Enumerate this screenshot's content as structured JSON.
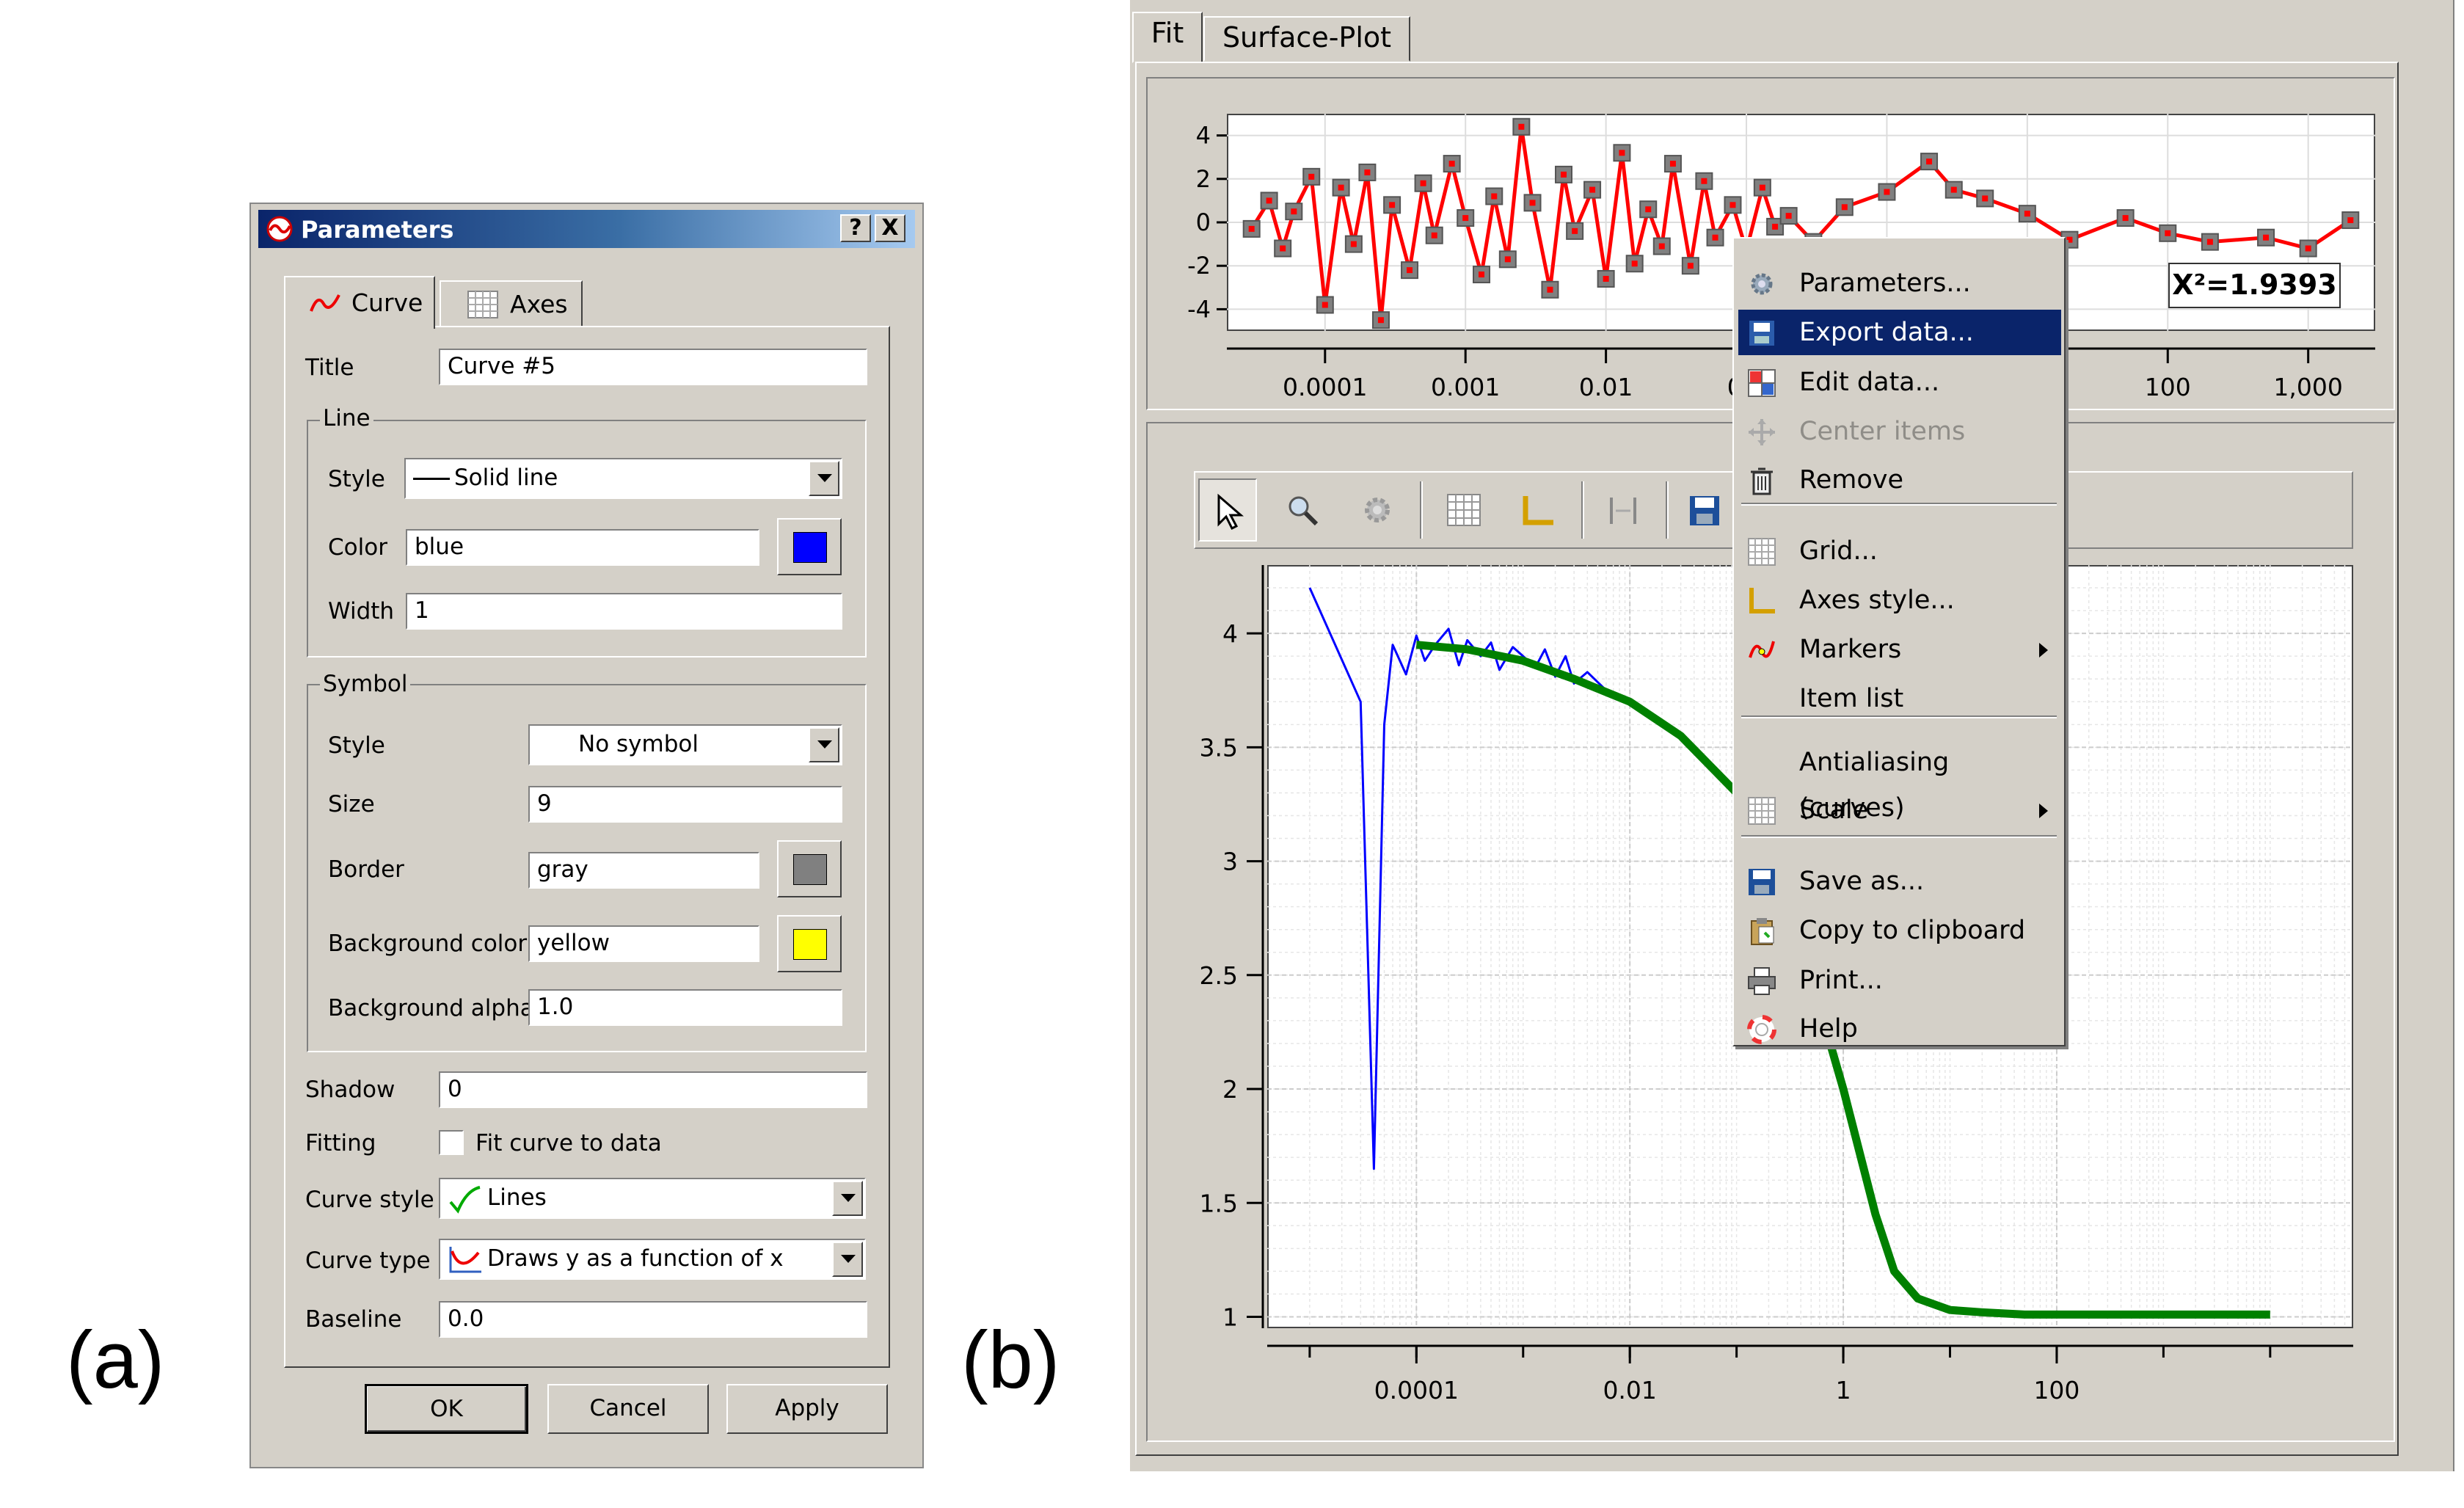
{
  "panels": {
    "a": "(a)",
    "b": "(b)"
  },
  "dialog": {
    "title": "Parameters",
    "help_btn": "?",
    "close_btn": "X",
    "tabs": [
      {
        "label": "Curve"
      },
      {
        "label": "Axes"
      }
    ],
    "title_label": "Title",
    "title_value": "Curve #5",
    "line": {
      "group": "Line",
      "style_label": "Style",
      "style_value": "Solid line",
      "color_label": "Color",
      "color_value": "blue",
      "color_swatch": "#0000ff",
      "width_label": "Width",
      "width_value": "1"
    },
    "symbol": {
      "group": "Symbol",
      "style_label": "Style",
      "style_value": "No symbol",
      "size_label": "Size",
      "size_value": "9",
      "border_label": "Border",
      "border_value": "gray",
      "border_swatch": "#808080",
      "bg_label": "Background color",
      "bg_value": "yellow",
      "bg_swatch": "#ffff00",
      "alpha_label": "Background alpha",
      "alpha_value": "1.0"
    },
    "shadow_label": "Shadow",
    "shadow_value": "0",
    "fitting_label": "Fitting",
    "fitting_check_label": "Fit curve to data",
    "fitting_checked": false,
    "curve_style_label": "Curve style",
    "curve_style_value": "Lines",
    "curve_type_label": "Curve type",
    "curve_type_value": "Draws y as a function of x",
    "baseline_label": "Baseline",
    "baseline_value": "0.0",
    "buttons": {
      "ok": "OK",
      "cancel": "Cancel",
      "apply": "Apply"
    }
  },
  "plot_window": {
    "tabs": [
      {
        "label": "Fit"
      },
      {
        "label": "Surface-Plot"
      }
    ],
    "chi2_label": "X²=1.9393",
    "toolbar_icons": [
      "pointer-icon",
      "zoom-icon",
      "gear-icon",
      "grid-icon",
      "axes-icon",
      "markers-icon",
      "save-icon"
    ]
  },
  "context_menu": {
    "items": [
      {
        "label": "Parameters...",
        "icon": "gear-icon",
        "state": "normal"
      },
      {
        "label": "Export data...",
        "icon": "export-icon",
        "state": "selected"
      },
      {
        "label": "Edit data...",
        "icon": "table-icon",
        "state": "normal"
      },
      {
        "label": "Center items",
        "icon": "move-icon",
        "state": "disabled"
      },
      {
        "label": "Remove",
        "icon": "trash-icon",
        "state": "normal"
      },
      {
        "label": "Grid...",
        "icon": "grid-icon",
        "state": "normal"
      },
      {
        "label": "Axes style...",
        "icon": "axes-icon",
        "state": "normal"
      },
      {
        "label": "Markers",
        "icon": "markers-icon",
        "state": "submenu"
      },
      {
        "label": "Item list",
        "icon": "",
        "state": "normal"
      },
      {
        "label": "Antialiasing (curves)",
        "icon": "",
        "state": "normal"
      },
      {
        "label": "Scale",
        "icon": "grid-icon",
        "state": "submenu"
      },
      {
        "label": "Save as...",
        "icon": "save-icon",
        "state": "normal"
      },
      {
        "label": "Copy to clipboard",
        "icon": "clipboard-icon",
        "state": "normal"
      },
      {
        "label": "Print...",
        "icon": "print-icon",
        "state": "normal"
      },
      {
        "label": "Help",
        "icon": "help-icon",
        "state": "normal"
      }
    ]
  },
  "chart_data": [
    {
      "type": "scatter",
      "title": "",
      "scale": "log-x",
      "x_ticks": [
        "0.0001",
        "0.001",
        "0.01",
        "0.1",
        "100",
        "1,000"
      ],
      "y_ticks": [
        "4",
        "2",
        "0",
        "-2",
        "-4"
      ],
      "ylim": [
        -5,
        5
      ],
      "series": [
        {
          "color": "#ff0000",
          "marker_color": "#808080",
          "x": [
            3e-05,
            4e-05,
            5e-05,
            6e-05,
            8e-05,
            0.0001,
            0.00013,
            0.00016,
            0.0002,
            0.00025,
            0.0003,
            0.0004,
            0.0005,
            0.0006,
            0.0008,
            0.001,
            0.0013,
            0.0016,
            0.002,
            0.0025,
            0.003,
            0.004,
            0.005,
            0.006,
            0.008,
            0.01,
            0.013,
            0.016,
            0.02,
            0.025,
            0.03,
            0.04,
            0.05,
            0.06,
            0.08,
            0.1,
            0.13,
            0.16,
            0.2,
            0.3,
            0.5,
            1,
            2,
            3,
            5,
            10,
            20,
            50,
            100,
            200,
            500,
            1000,
            2000
          ],
          "y": [
            -0.3,
            1.0,
            -1.2,
            0.5,
            2.1,
            -3.8,
            1.6,
            -1.0,
            2.3,
            -4.5,
            0.8,
            -2.2,
            1.8,
            -0.6,
            2.7,
            0.2,
            -2.4,
            1.2,
            -1.7,
            4.4,
            0.9,
            -3.1,
            2.2,
            -0.4,
            1.5,
            -2.6,
            3.2,
            -1.9,
            0.6,
            -1.1,
            2.7,
            -2.0,
            1.9,
            -0.7,
            0.8,
            -1.3,
            1.6,
            -0.2,
            0.3,
            -0.9,
            0.7,
            1.4,
            2.8,
            1.5,
            1.1,
            0.4,
            -0.8,
            0.2,
            -0.5,
            -0.9,
            -0.7,
            -1.2,
            0.1
          ]
        }
      ]
    },
    {
      "type": "line",
      "title": "",
      "scale": "log-x",
      "x_ticks": [
        "0.0001",
        "0.01",
        "1",
        "100"
      ],
      "y_ticks": [
        "4",
        "3.5",
        "3",
        "2.5",
        "2",
        "1.5",
        "1"
      ],
      "ylim": [
        0.95,
        4.3
      ],
      "series": [
        {
          "color": "#0000ff",
          "x": [
            1e-05,
            3e-05,
            4e-05,
            5e-05,
            6e-05,
            8e-05,
            0.0001,
            0.00012,
            0.00015,
            0.0002,
            0.00025,
            0.0003,
            0.0004,
            0.0005,
            0.0006,
            0.0008,
            0.001,
            0.0013,
            0.0016,
            0.002,
            0.0025,
            0.003,
            0.004,
            0.006,
            0.008,
            0.01
          ],
          "y": [
            4.2,
            3.7,
            1.65,
            3.6,
            3.95,
            3.82,
            3.99,
            3.88,
            3.95,
            4.02,
            3.86,
            3.97,
            3.9,
            3.96,
            3.84,
            3.94,
            3.9,
            3.85,
            3.93,
            3.81,
            3.9,
            3.78,
            3.83,
            3.75,
            3.72,
            3.7
          ]
        },
        {
          "color": "#008000",
          "x": [
            0.0001,
            0.0003,
            0.001,
            0.003,
            0.01,
            0.03,
            0.1,
            0.3,
            1,
            2,
            3,
            5,
            10,
            20,
            50,
            100,
            300,
            1000,
            3000,
            10000
          ],
          "y": [
            3.95,
            3.93,
            3.88,
            3.8,
            3.7,
            3.55,
            3.3,
            2.85,
            2.0,
            1.45,
            1.2,
            1.08,
            1.03,
            1.02,
            1.01,
            1.01,
            1.01,
            1.01,
            1.01,
            1.01
          ]
        }
      ]
    }
  ]
}
